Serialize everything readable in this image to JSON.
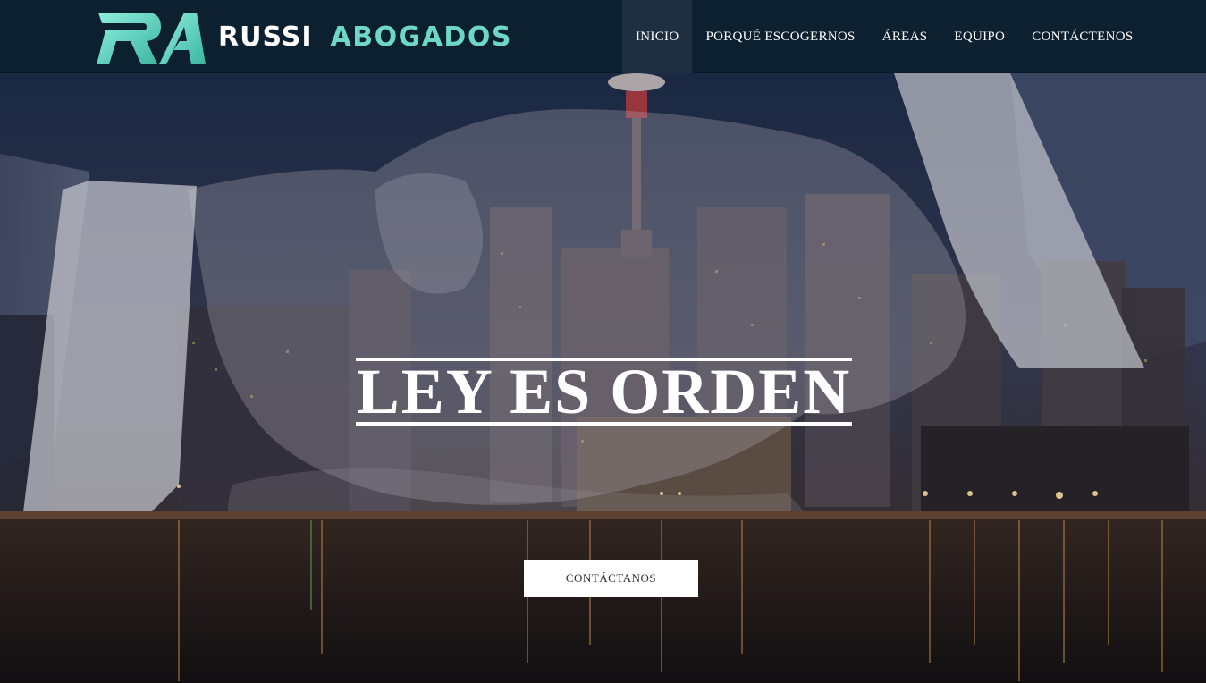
{
  "brand": {
    "name_part1": "RUSSI",
    "name_part2": "ABOGADOS",
    "colors": {
      "header_bg": "#0d2030",
      "accent": "#6ed7c6",
      "nav_active_bg": "#1d2f40"
    }
  },
  "nav": {
    "items": [
      {
        "label": "INICIO",
        "active": true
      },
      {
        "label": "PORQUÉ ESCOGERNOS",
        "active": false
      },
      {
        "label": "ÁREAS",
        "active": false
      },
      {
        "label": "EQUIPO",
        "active": false
      },
      {
        "label": "CONTÁCTENOS",
        "active": false
      }
    ]
  },
  "hero": {
    "headline": "LEY ES ORDEN",
    "cta_label": "CONTÁCTANOS",
    "background_description_icon": "handshake-city-skyline-image"
  }
}
